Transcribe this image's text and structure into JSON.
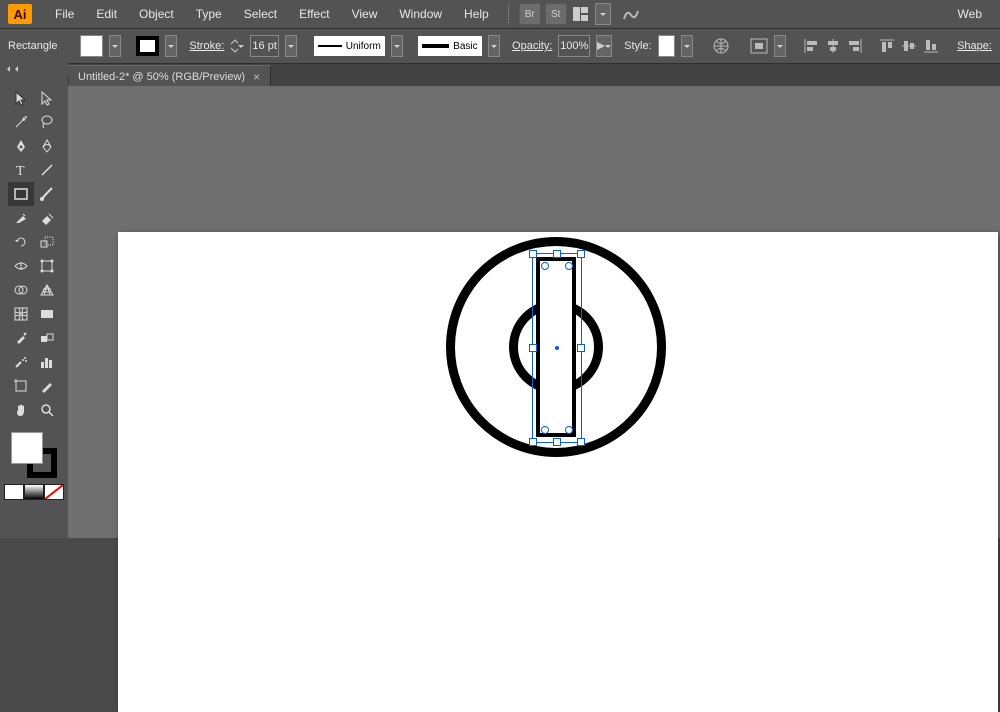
{
  "app": {
    "logo": "Ai"
  },
  "menu": {
    "file": "File",
    "edit": "Edit",
    "object": "Object",
    "type": "Type",
    "select": "Select",
    "effect": "Effect",
    "view": "View",
    "window": "Window",
    "help": "Help",
    "web": "Web"
  },
  "iconbtn": {
    "br": "Br",
    "st": "St"
  },
  "control": {
    "selection_label": "Rectangle",
    "stroke_label": "Stroke:",
    "stroke_value": "16 pt",
    "uniform_label": "Uniform",
    "basic_label": "Basic",
    "opacity_label": "Opacity:",
    "opacity_value": "100%",
    "style_label": "Style:",
    "shape_label": "Shape:"
  },
  "tab": {
    "title": "Untitled-2* @ 50% (RGB/Preview)"
  }
}
